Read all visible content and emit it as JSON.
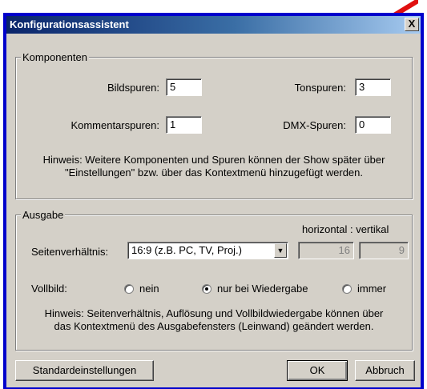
{
  "window": {
    "title": "Konfigurationsassistent",
    "close_label": "X"
  },
  "komponenten": {
    "legend": "Komponenten",
    "bildspuren_label": "Bildspuren:",
    "bildspuren_value": "5",
    "tonspuren_label": "Tonspuren:",
    "tonspuren_value": "3",
    "kommentarspuren_label": "Kommentarspuren:",
    "kommentarspuren_value": "1",
    "dmx_label": "DMX-Spuren:",
    "dmx_value": "0",
    "hint_line1": "Hinweis: Weitere Komponenten und Spuren können der Show später über",
    "hint_line2": "\"Einstellungen\" bzw. über das Kontextmenü hinzugefügt werden."
  },
  "ausgabe": {
    "legend": "Ausgabe",
    "hv_label": "horizontal : vertikal",
    "seitenverhaeltnis_label": "Seitenverhältnis:",
    "seitenverhaeltnis_value": "16:9 (z.B. PC, TV, Proj.)",
    "horizontal_value": "16",
    "vertikal_value": "9",
    "vollbild_label": "Vollbild:",
    "options": [
      "nein",
      "nur bei Wiedergabe",
      "immer"
    ],
    "selected_option": "nur bei Wiedergabe",
    "hint_line1": "Hinweis: Seitenverhältnis, Auflösung und Vollbildwiedergabe können über",
    "hint_line2": "das Kontextmenü des Ausgabefensters (Leinwand) geändert werden."
  },
  "buttons": {
    "defaults": "Standardeinstellungen",
    "ok": "OK",
    "cancel": "Abbruch"
  },
  "colors": {
    "annotation_arrow": "#e01010",
    "frame": "#0000cc"
  }
}
